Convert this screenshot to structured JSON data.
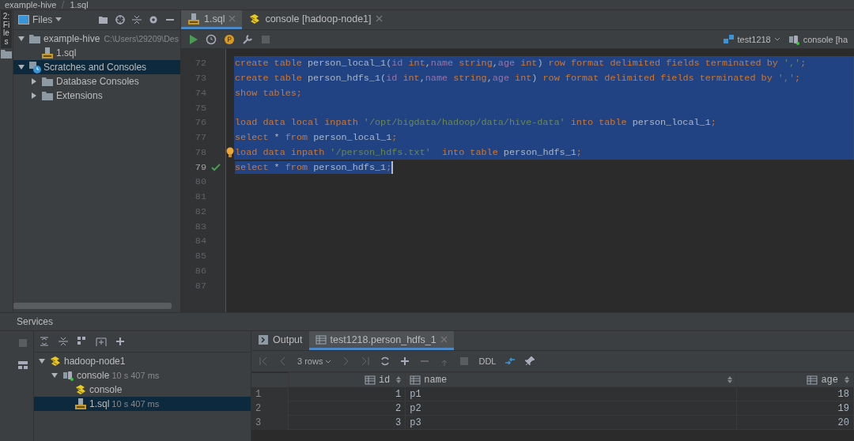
{
  "breadcrumb": [
    "example-hive",
    "1.sql"
  ],
  "side_strip": {
    "label": "2: Files"
  },
  "project": {
    "view": "Files",
    "tree": [
      {
        "label": "example-hive",
        "kind": "folder",
        "hint": "C:\\Users\\29209\\Des",
        "expanded": true,
        "selected": false,
        "children": [
          {
            "label": "1.sql",
            "kind": "sql",
            "selected": false
          }
        ]
      },
      {
        "label": "Scratches and Consoles",
        "kind": "scratches",
        "expanded": true,
        "selected": true,
        "children": [
          {
            "label": "Database Consoles",
            "kind": "folder",
            "expanded": false,
            "selected": false
          },
          {
            "label": "Extensions",
            "kind": "folder",
            "expanded": false,
            "selected": false
          }
        ]
      }
    ]
  },
  "editor": {
    "tabs": [
      {
        "label": "1.sql",
        "kind": "sql",
        "selected": true
      },
      {
        "label": "console [hadoop-node1]",
        "kind": "hive",
        "selected": false
      }
    ],
    "schema": "test1218",
    "console": "console [ha",
    "lines": [
      {
        "number": "72",
        "selected": true,
        "tokens": [
          {
            "kind": "kw",
            "text": "create table "
          },
          {
            "kind": "id",
            "text": "person_local_1("
          },
          {
            "kind": "field",
            "text": "id"
          },
          {
            "kind": "kw",
            "text": " int"
          },
          {
            "kind": "id",
            "text": ","
          },
          {
            "kind": "field",
            "text": "name"
          },
          {
            "kind": "kw",
            "text": " string"
          },
          {
            "kind": "id",
            "text": ","
          },
          {
            "kind": "field",
            "text": "age"
          },
          {
            "kind": "kw",
            "text": " int"
          },
          {
            "kind": "id",
            "text": ") "
          },
          {
            "kind": "kw",
            "text": "row format delimited fields terminated by "
          },
          {
            "kind": "str",
            "text": "','"
          },
          {
            "kind": "kw",
            "text": ";"
          }
        ]
      },
      {
        "number": "73",
        "selected": true,
        "tokens": [
          {
            "kind": "kw",
            "text": "create table "
          },
          {
            "kind": "id",
            "text": "person_hdfs_1("
          },
          {
            "kind": "field",
            "text": "id"
          },
          {
            "kind": "kw",
            "text": " int"
          },
          {
            "kind": "id",
            "text": ","
          },
          {
            "kind": "field",
            "text": "name"
          },
          {
            "kind": "kw",
            "text": " string"
          },
          {
            "kind": "id",
            "text": ","
          },
          {
            "kind": "field",
            "text": "age"
          },
          {
            "kind": "kw",
            "text": " int"
          },
          {
            "kind": "id",
            "text": ") "
          },
          {
            "kind": "kw",
            "text": "row format delimited fields terminated by "
          },
          {
            "kind": "str",
            "text": "','"
          },
          {
            "kind": "kw",
            "text": ";"
          }
        ]
      },
      {
        "number": "74",
        "selected": true,
        "tokens": [
          {
            "kind": "kw",
            "text": "show tables;"
          }
        ]
      },
      {
        "number": "75",
        "selected": true
      },
      {
        "number": "76",
        "selected": true,
        "tokens": [
          {
            "kind": "kw",
            "text": "load data local inpath "
          },
          {
            "kind": "str",
            "text": "'/opt/bigdata/hadoop/data/hive-data'"
          },
          {
            "kind": "kw",
            "text": " into table "
          },
          {
            "kind": "id",
            "text": "person_local_1"
          },
          {
            "kind": "kw",
            "text": ";"
          }
        ]
      },
      {
        "number": "77",
        "selected": true,
        "tokens": [
          {
            "kind": "kw",
            "text": "select "
          },
          {
            "kind": "id",
            "text": "* "
          },
          {
            "kind": "kw",
            "text": "from "
          },
          {
            "kind": "id",
            "text": "person_local_1"
          },
          {
            "kind": "kw",
            "text": ";"
          }
        ]
      },
      {
        "number": "78",
        "selected": true,
        "bulb": true,
        "tokens": [
          {
            "kind": "kw",
            "text": "load data inpath "
          },
          {
            "kind": "str",
            "text": "'/person_hdfs.txt'"
          },
          {
            "kind": "kw",
            "text": "  into table "
          },
          {
            "kind": "id",
            "text": "person_hdfs_1"
          },
          {
            "kind": "kw",
            "text": ";"
          }
        ]
      },
      {
        "number": "79",
        "selected": true,
        "caret": true,
        "check": true,
        "tokens": [
          {
            "kind": "kw",
            "text": "select "
          },
          {
            "kind": "id",
            "text": "* "
          },
          {
            "kind": "kw",
            "text": "from "
          },
          {
            "kind": "id",
            "text": "person_hdfs_1"
          },
          {
            "kind": "kw",
            "text": ";"
          }
        ]
      },
      {
        "number": "80",
        "selected": false
      },
      {
        "number": "81",
        "selected": false
      },
      {
        "number": "82",
        "selected": false
      },
      {
        "number": "83",
        "selected": false
      },
      {
        "number": "84",
        "selected": false
      },
      {
        "number": "85",
        "selected": false
      },
      {
        "number": "86",
        "selected": false
      },
      {
        "number": "87",
        "selected": false
      }
    ]
  },
  "services": {
    "title": "Services",
    "tree": [
      {
        "label": "hadoop-node1",
        "kind": "hive",
        "expanded": true,
        "selected": false,
        "children": [
          {
            "label": "console",
            "kind": "console",
            "time": "10 s 407 ms",
            "expanded": true,
            "selected": false,
            "children": [
              {
                "label": "console",
                "kind": "hive",
                "selected": false
              },
              {
                "label": "1.sql",
                "kind": "sql",
                "time": "10 s 407 ms",
                "selected": true
              }
            ]
          }
        ]
      }
    ]
  },
  "results": {
    "tabs": [
      {
        "label": "Output",
        "kind": "output",
        "selected": false
      },
      {
        "label": "test1218.person_hdfs_1",
        "kind": "table",
        "selected": true
      }
    ],
    "rows_label": "3 rows",
    "ddl": "DDL",
    "columns": [
      {
        "label": "id",
        "kind": "number"
      },
      {
        "label": "name",
        "kind": "text"
      },
      {
        "label": "age",
        "kind": "number"
      }
    ],
    "rows": [
      {
        "number": "1",
        "cells": [
          "1",
          "p1",
          "18"
        ]
      },
      {
        "number": "2",
        "cells": [
          "2",
          "p2",
          "19"
        ]
      },
      {
        "number": "3",
        "cells": [
          "3",
          "p3",
          "20"
        ]
      }
    ]
  }
}
